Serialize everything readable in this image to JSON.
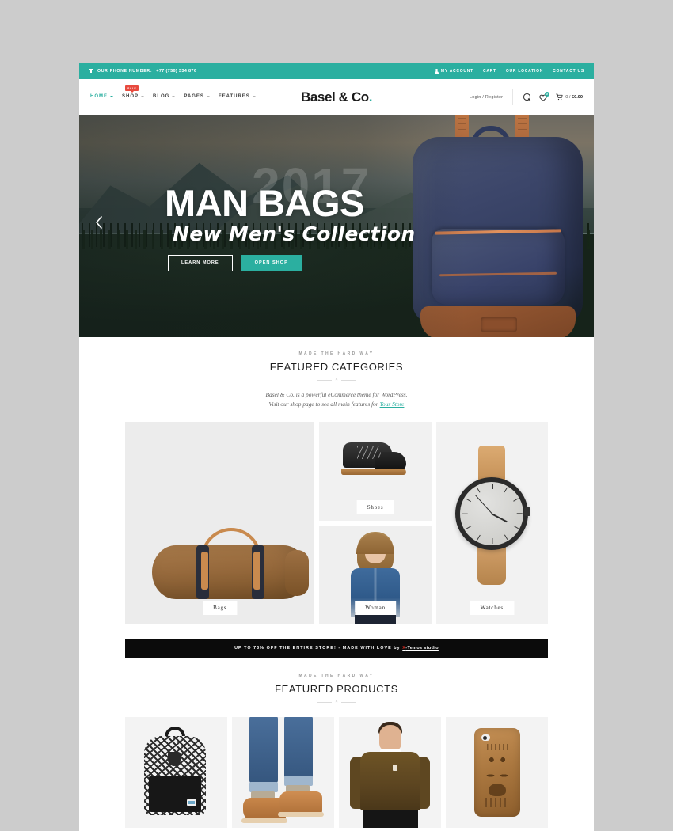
{
  "topbar": {
    "phone_label": "OUR PHONE NUMBER:",
    "phone_number": "+77 (756) 334 876",
    "links": [
      {
        "label": "MY ACCOUNT",
        "icon": "user-icon"
      },
      {
        "label": "CART"
      },
      {
        "label": "OUR LOCATION"
      },
      {
        "label": "CONTACT US"
      }
    ]
  },
  "header": {
    "nav": [
      {
        "label": "HOME",
        "active": true,
        "has_caret": true
      },
      {
        "label": "SHOP",
        "active": false,
        "has_caret": true,
        "badge": "SALE"
      },
      {
        "label": "BLOG",
        "active": false,
        "has_caret": true
      },
      {
        "label": "PAGES",
        "active": false,
        "has_caret": true
      },
      {
        "label": "FEATURES",
        "active": false,
        "has_caret": true
      }
    ],
    "logo_text": "Basel & Co",
    "logo_dot": ".",
    "login_label": "Login / Register",
    "wishlist_count": "0",
    "cart_text_count": "0 / ",
    "cart_amount": "£0.00"
  },
  "hero": {
    "year_watermark": "2017",
    "title": "MAN BAGS",
    "subtitle": "New Men's Collection",
    "btn_outline": "LEARN MORE",
    "btn_solid": "OPEN SHOP",
    "prev_arrow": "prev-slide-arrow"
  },
  "featured_categories": {
    "eyebrow": "MADE THE HARD WAY",
    "title": "FEATURED CATEGORIES",
    "divider": "×",
    "desc_line1": "Basel & Co. is a powerful eCommerce theme for WordPress.",
    "desc_line2_prefix": "Visit our shop page to see all main features for ",
    "desc_link": "Your Store",
    "items": [
      {
        "label": "Bags"
      },
      {
        "label": "Shoes"
      },
      {
        "label": "Woman"
      },
      {
        "label": "Watches"
      }
    ]
  },
  "promo": {
    "part1": "UP TO 70% OFF THE ENTIRE STORE! - MADE WITH LOVE ",
    "by": "by ",
    "brand_x": "X",
    "brand_rest": "-Temos studio"
  },
  "featured_products": {
    "eyebrow": "MADE THE HARD WAY",
    "title": "FEATURED PRODUCTS",
    "divider": "×",
    "items": [
      {
        "name": "patterned-backpack"
      },
      {
        "name": "tan-desert-boots"
      },
      {
        "name": "brown-knit-sweater"
      },
      {
        "name": "wooden-phone-case"
      }
    ]
  },
  "colors": {
    "accent_teal": "#2bafa0",
    "sale_red": "#e84a3e",
    "promo_black": "#0b0b0b",
    "page_background": "#cccccc"
  }
}
